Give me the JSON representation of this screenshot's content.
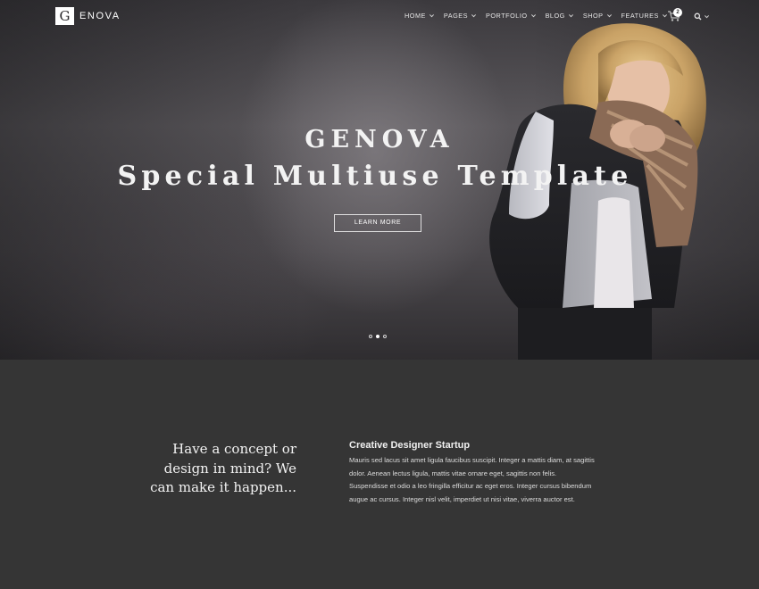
{
  "brand": {
    "logo_letter": "G",
    "name": "ENOVA"
  },
  "nav": {
    "items": [
      {
        "label": "HOME"
      },
      {
        "label": "PAGES"
      },
      {
        "label": "PORTFOLIO"
      },
      {
        "label": "BLOG"
      },
      {
        "label": "SHOP"
      },
      {
        "label": "FEATURES"
      }
    ],
    "cart_count": "2",
    "cart_icon": "cart-icon",
    "search_icon": "search-icon"
  },
  "hero": {
    "title": "GENOVA",
    "subtitle": "Special Multiuse Template",
    "button_label": "LEARN MORE",
    "slides": 3,
    "active_slide": 2
  },
  "intro": {
    "tagline": "Have a concept or design in mind? We can make it happen...",
    "heading": "Creative Designer Startup",
    "body": "Mauris sed lacus sit amet ligula faucibus suscipit. Integer a mattis diam, at sagittis dolor. Aenean lectus ligula, mattis vitae ornare eget, sagittis non felis. Suspendisse et odio a leo fringilla efficitur ac eget eros. Integer cursus bibendum augue ac cursus. Integer nisl velit, imperdiet ut nisi vitae, viverra auctor est."
  },
  "colors": {
    "background": "#353535",
    "hero_dark": "#3b393d",
    "text": "#ffffff"
  }
}
